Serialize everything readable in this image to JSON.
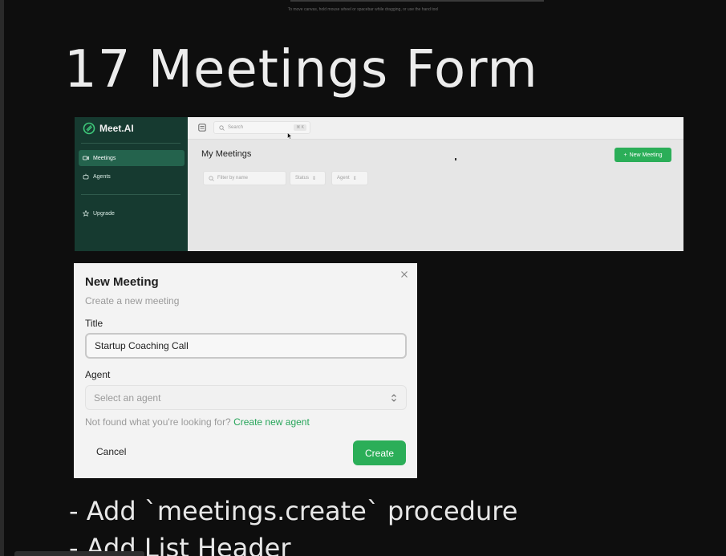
{
  "canvas_hint": "To move canvas, hold mouse wheel or spacebar while dragging, or use the hand tool",
  "slide_title": "17 Meetings Form",
  "app": {
    "logo_text": "Meet.AI",
    "sidebar": {
      "items": [
        {
          "label": "Meetings",
          "icon": "video-icon",
          "active": true
        },
        {
          "label": "Agents",
          "icon": "bot-icon",
          "active": false
        }
      ],
      "upgrade_label": "Upgrade"
    },
    "topbar": {
      "search_placeholder": "Search",
      "search_shortcut": "⌘ K"
    },
    "page_title": "My Meetings",
    "new_meeting_label": "New Meeting",
    "filters": {
      "name_placeholder": "Filter by name",
      "status_label": "Status",
      "agent_label": "Agent"
    },
    "accent_color": "#2bae58",
    "sidebar_color": "#163a30"
  },
  "dialog": {
    "title": "New Meeting",
    "subtitle": "Create a new meeting",
    "title_label": "Title",
    "title_value": "Startup Coaching Call",
    "agent_label": "Agent",
    "agent_placeholder": "Select an agent",
    "not_found_text": "Not found what you're looking for?",
    "create_agent_link": "Create new agent",
    "cancel_label": "Cancel",
    "create_label": "Create"
  },
  "bullets": [
    "- Add `meetings.create` procedure",
    "- Add List Header"
  ]
}
